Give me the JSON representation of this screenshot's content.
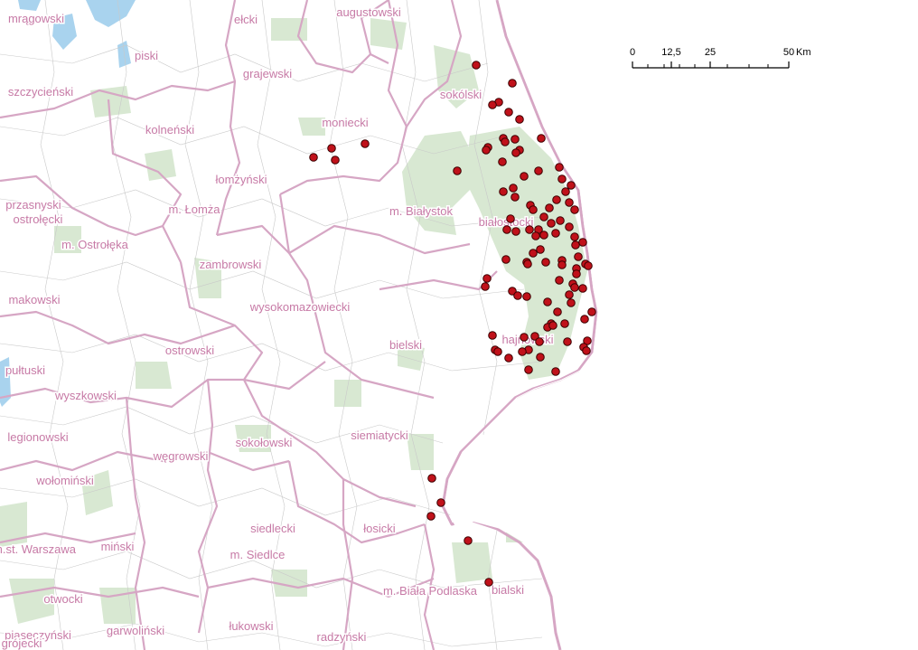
{
  "scale_bar": {
    "ticks": [
      "0",
      "12,5",
      "25",
      "50"
    ],
    "unit": "Km"
  },
  "district_labels": [
    "mrągowski",
    "ełcki",
    "augustowski",
    "piski",
    "grajewski",
    "szczycieński",
    "sokólski",
    "moniecki",
    "kolneński",
    "łomżyński",
    "przasnyski",
    "ostrołęcki",
    "m. Łomża",
    "m. Białystok",
    "białostocki",
    "m. Ostrołęka",
    "zambrowski",
    "makowski",
    "wysokomazowiecki",
    "ostrowski",
    "bielski",
    "hajnowski",
    "pułtuski",
    "wyszkowski",
    "legionowski",
    "węgrowski",
    "sokołowski",
    "siemiatycki",
    "wołomiński",
    "siedlecki",
    "łosicki",
    "m.st. Warszawa",
    "miński",
    "m. Siedlce",
    "m. Biała Podlaska",
    "bialski",
    "otwocki",
    "piaseczyński",
    "garwoliński",
    "łukowski",
    "radzyński",
    "grójecki"
  ],
  "colors": {
    "point_fill": "#c0111a",
    "point_stroke": "#3a0000",
    "boundary": "#d6a6c4",
    "forest": "#d8e8d2",
    "water": "#a9d3ee",
    "label": "#c77aa6"
  }
}
